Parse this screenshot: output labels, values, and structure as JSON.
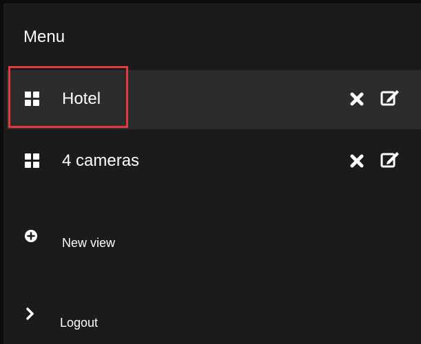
{
  "menu": {
    "title": "Menu",
    "views": [
      {
        "label": "Hotel",
        "selected": true,
        "icon": "grid-icon"
      },
      {
        "label": "4 cameras",
        "selected": false,
        "icon": "grid-icon"
      }
    ],
    "row_actions": {
      "delete_icon": "delete-icon",
      "edit_icon": "edit-icon"
    },
    "actions": [
      {
        "label": "New view",
        "icon": "plus-circle-icon"
      },
      {
        "label": "Logout",
        "icon": "chevron-right-icon"
      }
    ]
  },
  "colors": {
    "background": "#1b1b1b",
    "selected_row": "#2c2c2c",
    "text": "#ffffff",
    "highlight": "#e23b3b"
  }
}
